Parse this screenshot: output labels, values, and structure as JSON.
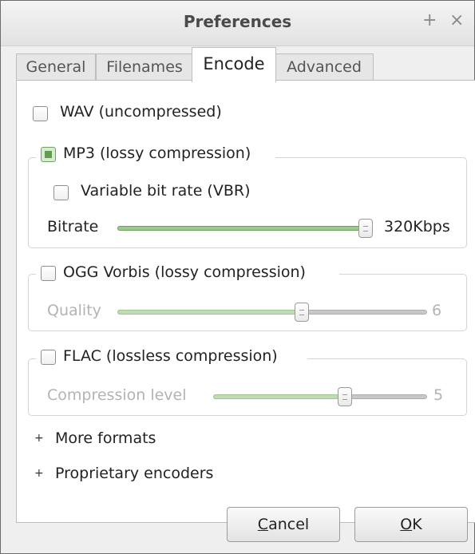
{
  "window": {
    "title": "Preferences",
    "add_icon": "plus-icon",
    "close_icon": "close-icon"
  },
  "tabs": [
    {
      "label": "General",
      "active": false
    },
    {
      "label": "Filenames",
      "active": false
    },
    {
      "label": "Encode",
      "active": true
    },
    {
      "label": "Advanced",
      "active": false
    }
  ],
  "encode": {
    "wav": {
      "label": "WAV (uncompressed)",
      "checked": false
    },
    "mp3": {
      "label": "MP3 (lossy compression)",
      "checked": true,
      "vbr": {
        "label": "Variable bit rate (VBR)",
        "checked": false
      },
      "bitrate": {
        "label": "Bitrate",
        "value": "320Kbps",
        "fraction": 1.0
      }
    },
    "ogg": {
      "label": "OGG Vorbis (lossy compression)",
      "checked": false,
      "quality": {
        "label": "Quality",
        "value": "6",
        "fraction": 0.6
      }
    },
    "flac": {
      "label": "FLAC (lossless compression)",
      "checked": false,
      "compression": {
        "label": "Compression level",
        "value": "5",
        "fraction": 0.625
      }
    },
    "more_formats": {
      "label": "More formats",
      "icon": "plus-expander-icon"
    },
    "proprietary": {
      "label": "Proprietary encoders",
      "icon": "plus-expander-icon"
    }
  },
  "buttons": {
    "cancel": {
      "label": "Cancel",
      "mnemonic": "C"
    },
    "ok": {
      "label": "OK",
      "mnemonic": "O"
    }
  },
  "colors": {
    "slider_fill": "#9cc98c",
    "slider_track": "#c8c8c8",
    "window_bg": "#efefef"
  }
}
